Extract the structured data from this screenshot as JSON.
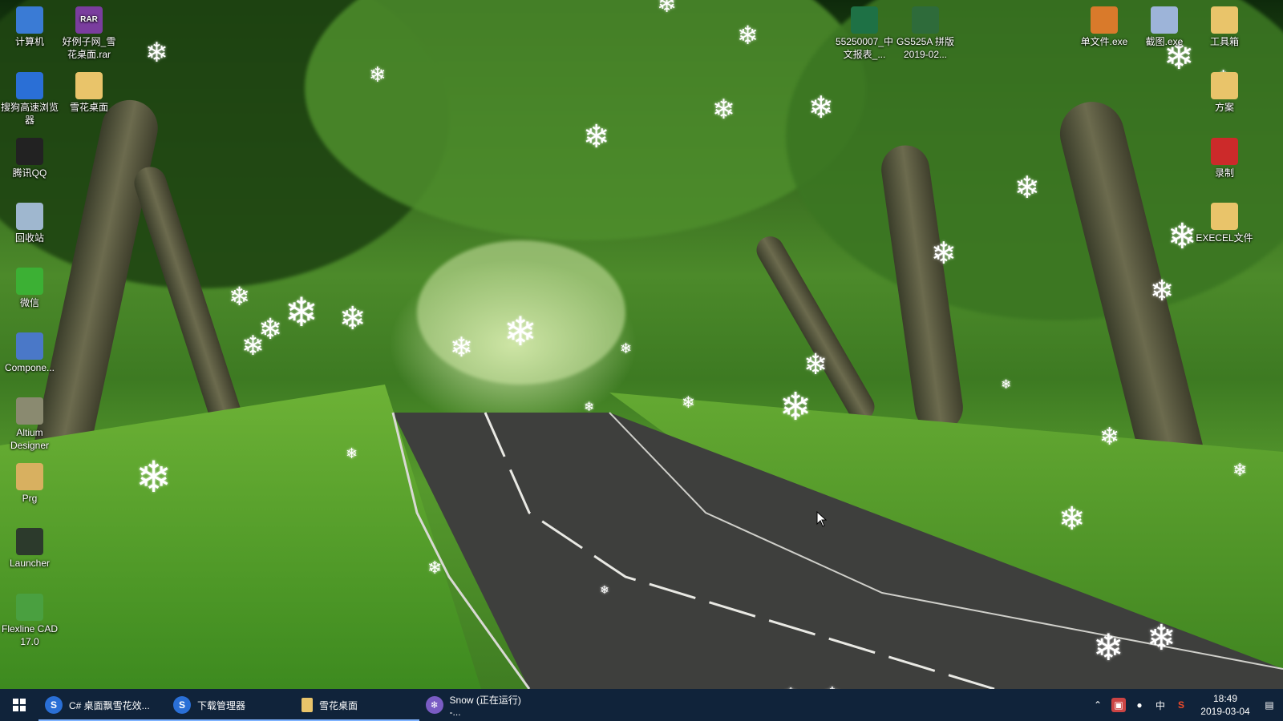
{
  "desktop_icons_left": [
    {
      "label": "计算机",
      "icon": "computer-icon",
      "color": "#3a7bd5"
    },
    {
      "label": "搜狗高速浏览器",
      "icon": "sogou-browser-icon",
      "color": "#2a6fd6"
    },
    {
      "label": "腾讯QQ",
      "icon": "qq-icon",
      "color": "#222222"
    },
    {
      "label": "回收站",
      "icon": "recycle-bin-icon",
      "color": "#9fb7cf"
    },
    {
      "label": "微信",
      "icon": "wechat-icon",
      "color": "#3cb034"
    },
    {
      "label": "Compone...",
      "icon": "component-icon",
      "color": "#4a78c8"
    },
    {
      "label": "Altium Designer",
      "icon": "altium-icon",
      "color": "#8a8a70"
    },
    {
      "label": "Prg",
      "icon": "prg-icon",
      "color": "#d8b060"
    },
    {
      "label": "Launcher",
      "icon": "launcher-icon",
      "color": "#2c3a2c"
    },
    {
      "label": "Flexline CAD 17.0",
      "icon": "flexline-cad-icon",
      "color": "#4aa040"
    }
  ],
  "desktop_icons_col2": [
    {
      "label": "好例子网_雪花桌面.rar",
      "icon": "rar-icon",
      "color": "#7a3d9e",
      "glyph": "RAR"
    },
    {
      "label": "雪花桌面",
      "icon": "folder-icon",
      "color": "#e9c46a"
    }
  ],
  "desktop_icons_top": [
    {
      "label": "55250007_中文报表_...",
      "icon": "excel-file-icon",
      "color": "#1e7145"
    },
    {
      "label": "GS525A 拼版2019-02...",
      "icon": "pcb-file-icon",
      "color": "#2e6b3a"
    }
  ],
  "desktop_icons_right": [
    {
      "label": "单文件.exe",
      "icon": "exe-file-icon",
      "color": "#d97a2b"
    },
    {
      "label": "截图.exe",
      "icon": "screenshot-exe-icon",
      "color": "#9db4d9"
    },
    {
      "label": "工具箱",
      "icon": "toolbox-folder-icon",
      "color": "#e9c46a"
    },
    {
      "label": "方案",
      "icon": "plan-folder-icon",
      "color": "#e9c46a"
    },
    {
      "label": "录制",
      "icon": "record-icon",
      "color": "#cc2a2a"
    },
    {
      "label": "EXECEL文件",
      "icon": "excel-folder-icon",
      "color": "#e9c46a"
    }
  ],
  "taskbar": {
    "items": [
      {
        "label": "C# 桌面飘雪花效...",
        "icon": "sogou-browser-icon",
        "color": "#2a6fd6",
        "glyph": "S"
      },
      {
        "label": "下载管理器",
        "icon": "download-manager-icon",
        "color": "#2a6fd6",
        "glyph": "S"
      },
      {
        "label": "雪花桌面",
        "icon": "folder-icon",
        "color": "#e9c46a",
        "glyph": ""
      },
      {
        "label": "Snow (正在运行) -...",
        "icon": "snow-app-icon",
        "color": "#7a5cc4",
        "glyph": "❄"
      }
    ],
    "tray": {
      "ime": "中",
      "time": "18:49",
      "date": "2019-03-04"
    }
  }
}
